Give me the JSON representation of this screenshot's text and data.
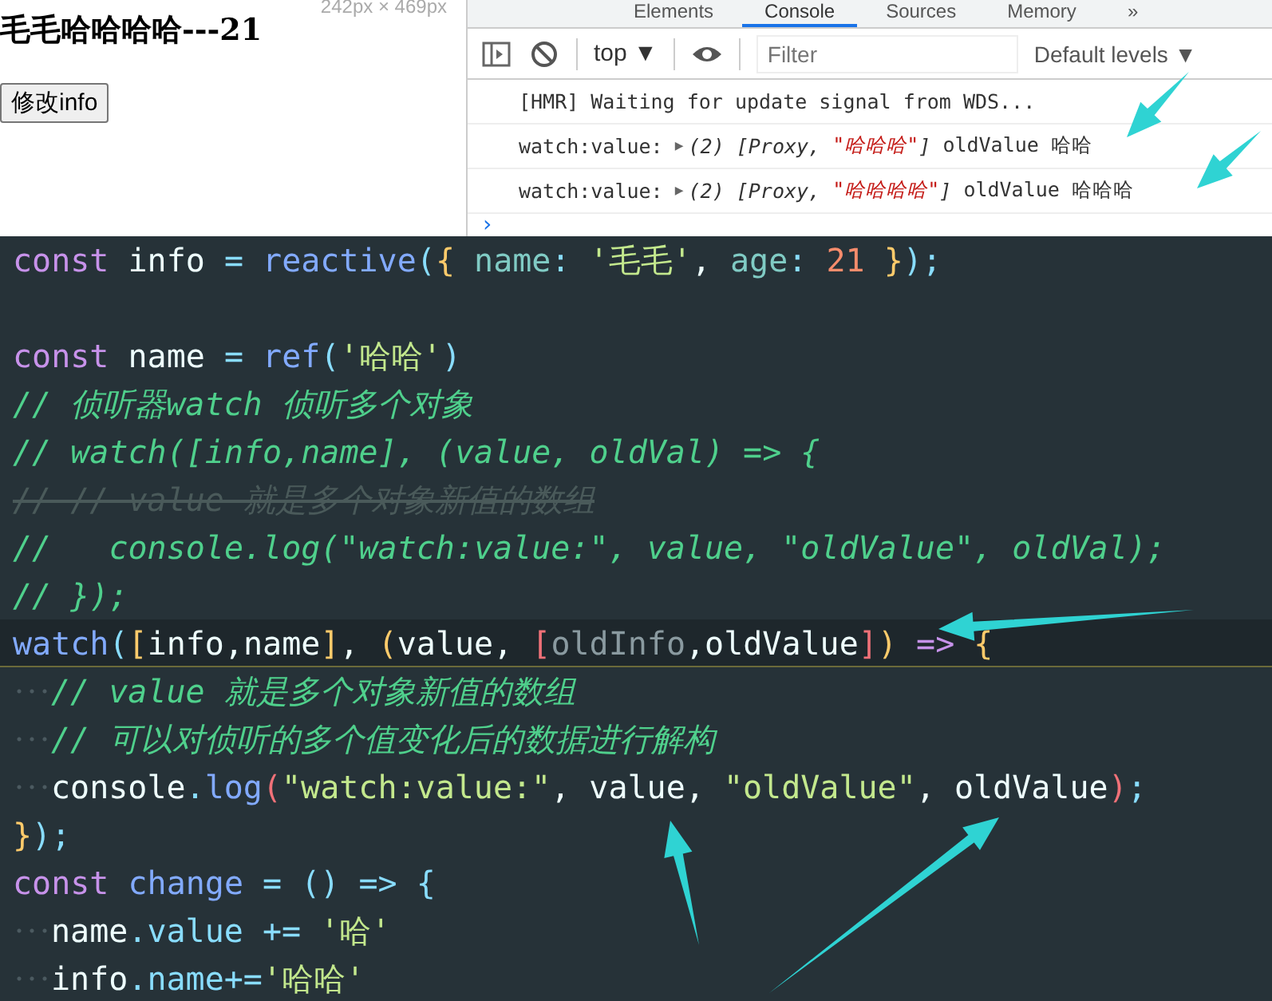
{
  "preview": {
    "size_label": "242px × 469px",
    "heading": "毛毛哈哈哈哈---21",
    "button": "修改info"
  },
  "devtools": {
    "tabs": [
      {
        "label": "Elements",
        "selected": false
      },
      {
        "label": "Console",
        "selected": true
      },
      {
        "label": "Sources",
        "selected": false
      },
      {
        "label": "Memory",
        "selected": false
      },
      {
        "label": "»",
        "selected": false
      }
    ],
    "context": {
      "label": "top",
      "caret": "▼"
    },
    "filter": {
      "placeholder": "Filter"
    },
    "levels": {
      "label": "Default levels",
      "caret": "▼"
    },
    "console": [
      {
        "parts": [
          {
            "text": "[HMR] Waiting for update signal from WDS...",
            "kind": "plain"
          }
        ]
      },
      {
        "parts": [
          {
            "text": "watch:value: ",
            "kind": "plain"
          },
          {
            "text": "▶",
            "kind": "toggle"
          },
          {
            "text": "(2) [Proxy, ",
            "kind": "italic"
          },
          {
            "text": "\"哈哈哈\"",
            "kind": "string"
          },
          {
            "text": "]",
            "kind": "italic"
          },
          {
            "text": " oldValue 哈哈",
            "kind": "plain"
          }
        ]
      },
      {
        "parts": [
          {
            "text": "watch:value: ",
            "kind": "plain"
          },
          {
            "text": "▶",
            "kind": "toggle"
          },
          {
            "text": "(2) [Proxy, ",
            "kind": "italic"
          },
          {
            "text": "\"哈哈哈哈\"",
            "kind": "string"
          },
          {
            "text": "]",
            "kind": "italic"
          },
          {
            "text": " oldValue 哈哈哈",
            "kind": "plain"
          }
        ]
      }
    ],
    "prompt": "›"
  },
  "editor": {
    "lines": [
      {
        "current": false,
        "tokens": [
          {
            "text": "const",
            "kind": "kw"
          },
          {
            "text": " info ",
            "kind": "var"
          },
          {
            "text": "=",
            "kind": "op"
          },
          {
            "text": " reactive",
            "kind": "fn"
          },
          {
            "text": "(",
            "kind": "op"
          },
          {
            "text": "{",
            "kind": "brace"
          },
          {
            "text": " name",
            "kind": "prop"
          },
          {
            "text": ": ",
            "kind": "op"
          },
          {
            "text": "'毛毛'",
            "kind": "str"
          },
          {
            "text": ", ",
            "kind": "var"
          },
          {
            "text": "age",
            "kind": "prop"
          },
          {
            "text": ": ",
            "kind": "op"
          },
          {
            "text": "21",
            "kind": "num"
          },
          {
            "text": " }",
            "kind": "brace"
          },
          {
            "text": ");",
            "kind": "op"
          }
        ]
      },
      {
        "current": false
      },
      {
        "current": false,
        "tokens": [
          {
            "text": "const",
            "kind": "kw"
          },
          {
            "text": " name ",
            "kind": "var"
          },
          {
            "text": "=",
            "kind": "op"
          },
          {
            "text": " ref",
            "kind": "fn"
          },
          {
            "text": "(",
            "kind": "op"
          },
          {
            "text": "'哈哈'",
            "kind": "str"
          },
          {
            "text": ")",
            "kind": "op"
          }
        ]
      },
      {
        "current": false,
        "tokens": [
          {
            "text": "// 侦听器watch 侦听多个对象",
            "kind": "comment"
          }
        ]
      },
      {
        "current": false,
        "tokens": [
          {
            "text": "// watch([info,name], (value, oldVal) => {",
            "kind": "comment"
          }
        ]
      },
      {
        "current": false,
        "tokens": [
          {
            "text": "// // value 就是多个对象新值的数组",
            "kind": "struck"
          }
        ]
      },
      {
        "current": false,
        "tokens": [
          {
            "text": "//   console.log(\"watch:value:\", value, \"oldValue\", oldVal);",
            "kind": "comment"
          }
        ]
      },
      {
        "current": false,
        "tokens": [
          {
            "text": "// });",
            "kind": "comment"
          }
        ]
      },
      {
        "current": true,
        "tokens": [
          {
            "text": "watch",
            "kind": "fn"
          },
          {
            "text": "(",
            "kind": "op"
          },
          {
            "text": "[",
            "kind": "brace"
          },
          {
            "text": "info,name",
            "kind": "var"
          },
          {
            "text": "]",
            "kind": "brace"
          },
          {
            "text": ", ",
            "kind": "var"
          },
          {
            "text": "(",
            "kind": "brace"
          },
          {
            "text": "value, ",
            "kind": "var"
          },
          {
            "text": "[",
            "kind": "pink"
          },
          {
            "text": "oldInfo",
            "kind": "dim"
          },
          {
            "text": ",oldValue",
            "kind": "var"
          },
          {
            "text": "]",
            "kind": "pink"
          },
          {
            "text": ")",
            "kind": "brace"
          },
          {
            "text": " => ",
            "kind": "kw"
          },
          {
            "text": "{",
            "kind": "brace"
          }
        ]
      },
      {
        "current": false,
        "guide": true,
        "tokens": [
          {
            "text": "// value 就是多个对象新值的数组",
            "kind": "comment"
          }
        ]
      },
      {
        "current": false,
        "guide": true,
        "tokens": [
          {
            "text": "// 可以对侦听的多个值变化后的数据进行解构",
            "kind": "comment"
          }
        ]
      },
      {
        "current": false,
        "guide": true,
        "tokens": [
          {
            "text": "console",
            "kind": "var"
          },
          {
            "text": ".",
            "kind": "op"
          },
          {
            "text": "log",
            "kind": "fn"
          },
          {
            "text": "(",
            "kind": "pink"
          },
          {
            "text": "\"watch:value:\"",
            "kind": "str"
          },
          {
            "text": ", value, ",
            "kind": "var"
          },
          {
            "text": "\"oldValue\"",
            "kind": "str"
          },
          {
            "text": ", oldValue",
            "kind": "var"
          },
          {
            "text": ")",
            "kind": "pink"
          },
          {
            "text": ";",
            "kind": "op"
          }
        ]
      },
      {
        "current": false,
        "tokens": [
          {
            "text": "}",
            "kind": "brace"
          },
          {
            "text": ");",
            "kind": "op"
          }
        ]
      },
      {
        "current": false,
        "tokens": [
          {
            "text": "const",
            "kind": "kw"
          },
          {
            "text": " change ",
            "kind": "fn"
          },
          {
            "text": "=",
            "kind": "op"
          },
          {
            "text": " () => ",
            "kind": "op"
          },
          {
            "text": "{",
            "kind": "op"
          }
        ]
      },
      {
        "current": false,
        "guide": true,
        "tokens": [
          {
            "text": "name",
            "kind": "var"
          },
          {
            "text": ".value ",
            "kind": "op"
          },
          {
            "text": "+=",
            "kind": "op"
          },
          {
            "text": " '哈'",
            "kind": "str"
          }
        ]
      },
      {
        "current": false,
        "guide": true,
        "tokens": [
          {
            "text": "info",
            "kind": "var"
          },
          {
            "text": ".name",
            "kind": "op"
          },
          {
            "text": "+=",
            "kind": "op"
          },
          {
            "text": "'哈哈'",
            "kind": "str"
          }
        ]
      }
    ]
  }
}
